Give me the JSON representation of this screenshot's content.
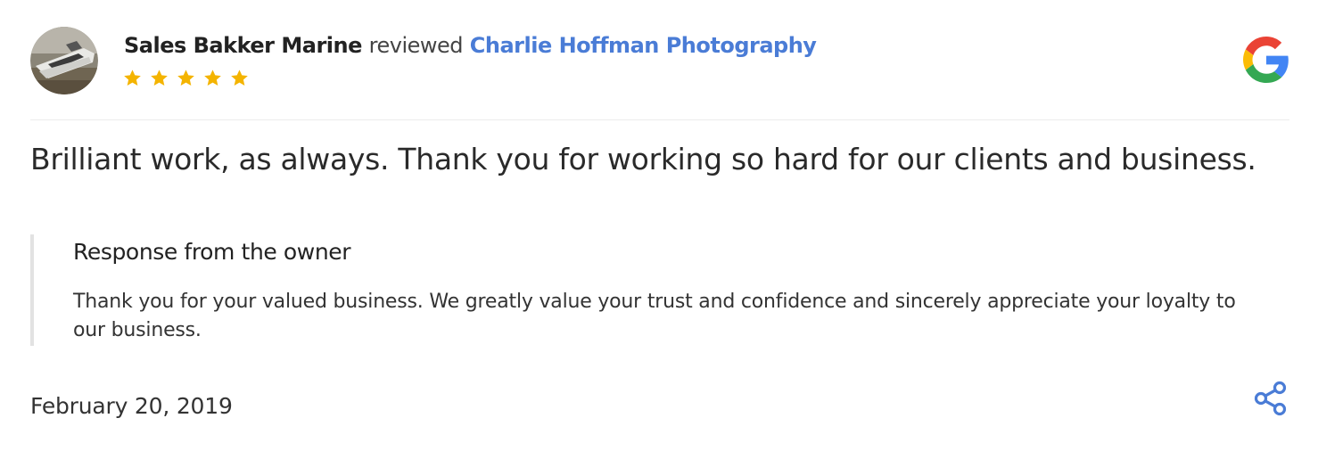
{
  "review": {
    "reviewer_name": "Sales Bakker Marine",
    "verb": "reviewed",
    "business_name": "Charlie Hoffman Photography",
    "rating": 5,
    "rating_max": 5,
    "text": "Brilliant work, as always. Thank you for working so hard for our clients and business.",
    "date": "February 20, 2019"
  },
  "owner_response": {
    "title": "Response from the owner",
    "body": "Thank you for your valued business. We greatly value your trust and confidence and sincerely appreciate your loyalty to our business."
  },
  "icons": {
    "source": "google-g-icon",
    "share": "share-icon",
    "star": "star-icon",
    "avatar": "boat-avatar"
  },
  "colors": {
    "link": "#4a7cd6",
    "star": "#f4b400",
    "share": "#4a7cd6",
    "google_blue": "#4285f4",
    "google_red": "#ea4335",
    "google_yellow": "#fbbc05",
    "google_green": "#34a853"
  }
}
